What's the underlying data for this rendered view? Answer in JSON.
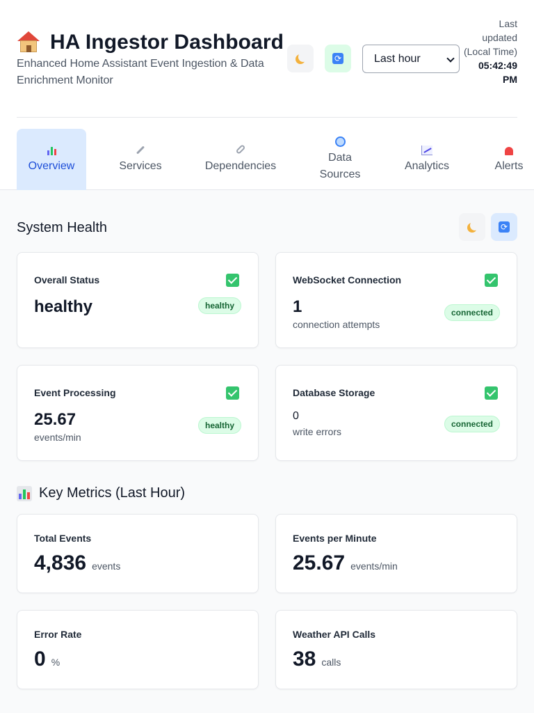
{
  "header": {
    "title": "HA Ingestor Dashboard",
    "subtitle": "Enhanced Home Assistant Event Ingestion & Data Enrichment Monitor",
    "time_range": "Last hour",
    "last_updated_label": "Last updated (Local Time)",
    "last_updated_time": "05:42:49 PM"
  },
  "tabs": [
    {
      "label": "Overview",
      "icon": "bar-chart-icon",
      "active": true
    },
    {
      "label": "Services",
      "icon": "wrench-icon",
      "active": false
    },
    {
      "label": "Dependencies",
      "icon": "link-icon",
      "active": false
    },
    {
      "label": "Data Sources",
      "icon": "globe-icon",
      "active": false
    },
    {
      "label": "Analytics",
      "icon": "trend-chart-icon",
      "active": false
    },
    {
      "label": "Alerts",
      "icon": "siren-icon",
      "active": false
    }
  ],
  "system_health": {
    "title": "System Health",
    "cards": [
      {
        "label": "Overall Status",
        "value": "healthy",
        "badge": "healthy"
      },
      {
        "label": "WebSocket Connection",
        "value": "1",
        "sub": "connection attempts",
        "badge": "connected"
      },
      {
        "label": "Event Processing",
        "value": "25.67",
        "sub": "events/min",
        "badge": "healthy"
      },
      {
        "label": "Database Storage",
        "value": "0",
        "sub": "write errors",
        "badge": "connected"
      }
    ]
  },
  "key_metrics": {
    "title": "Key Metrics (Last Hour)",
    "cards": [
      {
        "label": "Total Events",
        "value": "4,836",
        "unit": "events"
      },
      {
        "label": "Events per Minute",
        "value": "25.67",
        "unit": "events/min"
      },
      {
        "label": "Error Rate",
        "value": "0",
        "unit": "%"
      },
      {
        "label": "Weather API Calls",
        "value": "38",
        "unit": "calls"
      }
    ]
  },
  "colors": {
    "accent": "#1d4ed8",
    "active_tab_bg": "#dbeafe",
    "success_badge_bg": "#dcfce7",
    "success_text": "#166534"
  }
}
